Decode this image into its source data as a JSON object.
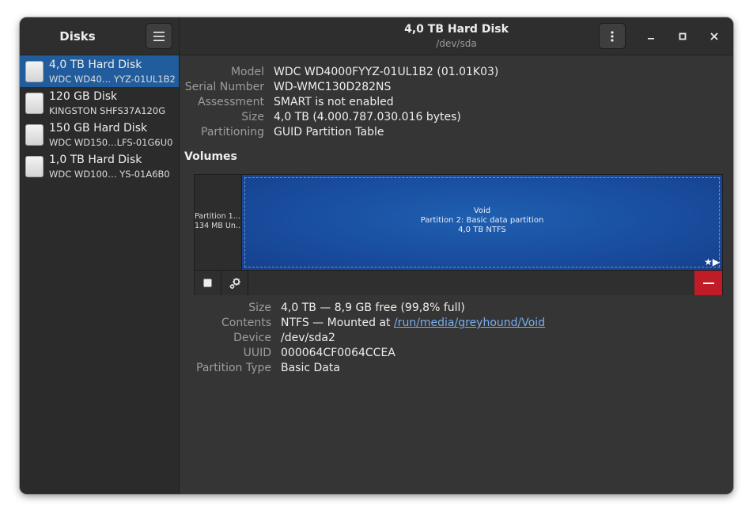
{
  "sidebar": {
    "title": "Disks",
    "disks": [
      {
        "name": "4,0 TB Hard Disk",
        "model": "WDC WD40… YYZ-01UL1B2",
        "selected": true
      },
      {
        "name": "120 GB Disk",
        "model": "KINGSTON SHFS37A120G",
        "selected": false
      },
      {
        "name": "150 GB Hard Disk",
        "model": "WDC WD150…LFS-01G6U0",
        "selected": false
      },
      {
        "name": "1,0 TB Hard Disk",
        "model": "WDC WD100…  YS-01A6B0",
        "selected": false
      }
    ]
  },
  "header": {
    "title": "4,0 TB Hard Disk",
    "subtitle": "/dev/sda"
  },
  "drive": {
    "model_label": "Model",
    "model": "WDC WD4000FYYZ-01UL1B2 (01.01K03)",
    "serial_label": "Serial Number",
    "serial": "WD-WMC130D282NS",
    "assessment_label": "Assessment",
    "assessment": "SMART is not enabled",
    "size_label": "Size",
    "size": "4,0 TB (4.000.787.030.016 bytes)",
    "partitioning_label": "Partitioning",
    "partitioning": "GUID Partition Table"
  },
  "volumes": {
    "heading": "Volumes",
    "partition1": {
      "line1": "Partition 1…",
      "line2": "134 MB Un…"
    },
    "partition2": {
      "line1": "Void",
      "line2": "Partition 2: Basic data partition",
      "line3": "4,0 TB NTFS"
    }
  },
  "partition": {
    "size_label": "Size",
    "size": "4,0 TB — 8,9 GB free (99,8% full)",
    "contents_label": "Contents",
    "contents_prefix": "NTFS — Mounted at ",
    "mount_link": "/run/media/greyhound/Void",
    "device_label": "Device",
    "device": "/dev/sda2",
    "uuid_label": "UUID",
    "uuid": "000064CF0064CCEA",
    "type_label": "Partition Type",
    "type": "Basic Data"
  },
  "colors": {
    "accent": "#215d9c",
    "partition": "#18499a",
    "destructive": "#c01c28"
  }
}
